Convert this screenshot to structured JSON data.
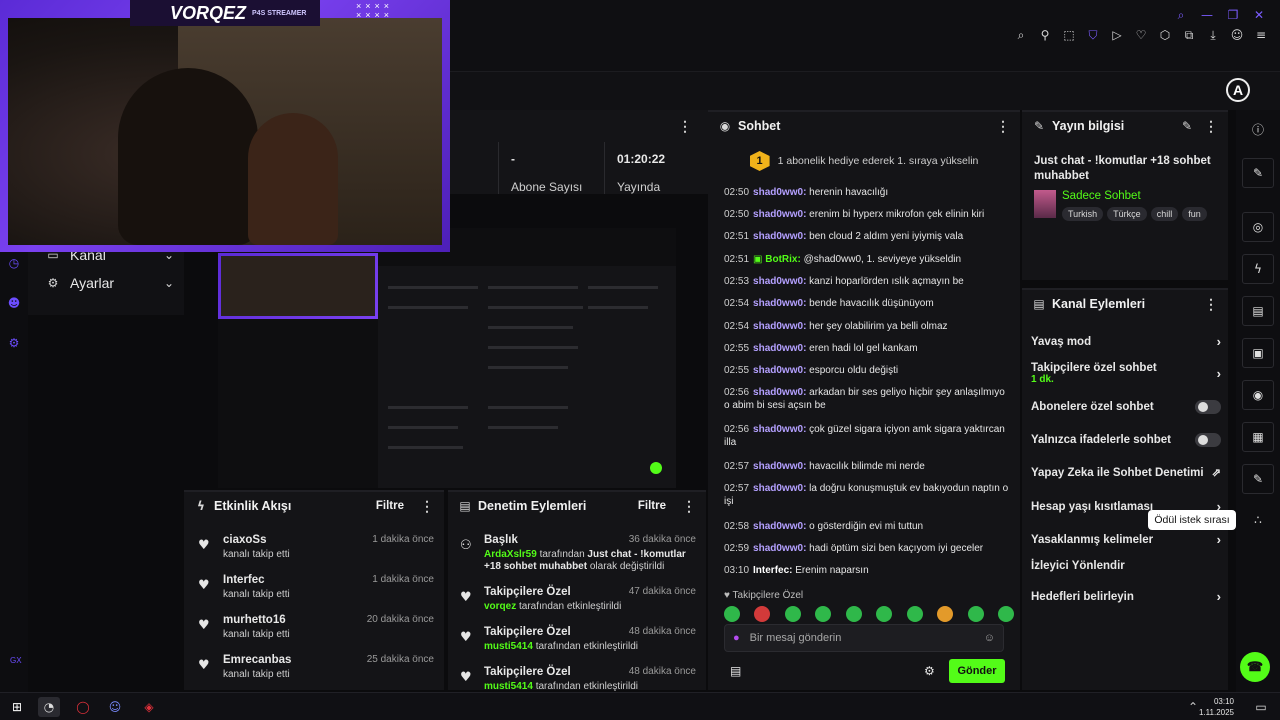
{
  "webcam": {
    "brand": "VORQEZ",
    "tagline": "P4S STREAMER"
  },
  "sidebar": {
    "items": [
      {
        "label": "Kanal"
      },
      {
        "label": "Ayarlar"
      }
    ],
    "gx": "GX"
  },
  "stats": {
    "subs_value": "-",
    "subs_label": "Abone Sayısı",
    "uptime_value": "01:20:22",
    "uptime_label": "Yayında"
  },
  "chat": {
    "title": "Sohbet",
    "banner": "1 abonelik hediye ederek 1. sıraya yükselin",
    "banner_rank": "1",
    "messages": [
      {
        "time": "02:50",
        "user": "shad0ww0",
        "text": "herenin havacılığı"
      },
      {
        "time": "02:50",
        "user": "shad0ww0",
        "text": "erenim bi hyperx mikrofon çek elinin kiri"
      },
      {
        "time": "02:51",
        "user": "shad0ww0",
        "text": "ben cloud 2 aldım yeni iyiymiş vala"
      },
      {
        "time": "02:51",
        "user": "BotRix",
        "text": "@shad0ww0, 1. seviyeye yükseldin",
        "bot": true
      },
      {
        "time": "02:53",
        "user": "shad0ww0",
        "text": "kanzi hoparlörden ıslık açmayın be"
      },
      {
        "time": "02:54",
        "user": "shad0ww0",
        "text": "bende havacılık düşünüyom"
      },
      {
        "time": "02:54",
        "user": "shad0ww0",
        "text": "her şey olabilirim ya belli olmaz"
      },
      {
        "time": "02:55",
        "user": "shad0ww0",
        "text": "eren hadi lol gel kankam"
      },
      {
        "time": "02:55",
        "user": "shad0ww0",
        "text": "esporcu oldu değişti"
      },
      {
        "time": "02:56",
        "user": "shad0ww0",
        "text": "arkadan bir ses geliyo hiçbir şey anlaşılmıyo o abim bi sesi açsın be"
      },
      {
        "time": "02:56",
        "user": "shad0ww0",
        "text": "çok güzel sigara içiyon amk sigara yaktırcan illa"
      },
      {
        "time": "02:57",
        "user": "shad0ww0",
        "text": "havacılık bilimde mi nerde"
      },
      {
        "time": "02:57",
        "user": "shad0ww0",
        "text": "la doğru konuşmuştuk ev bakıyodun naptın o işi"
      },
      {
        "time": "02:58",
        "user": "shad0ww0",
        "text": "o gösterdiğin evi mi tuttun"
      },
      {
        "time": "02:59",
        "user": "shad0ww0",
        "text": "hadi öptüm sizi ben kaçıyom iyi geceler"
      },
      {
        "time": "03:10",
        "user": "Interfec",
        "text": "Erenim naparsın",
        "white": true
      }
    ],
    "followers_only": "Takipçilere Özel",
    "input_placeholder": "Bir mesaj gönderin",
    "send_label": "Gönder"
  },
  "stream_info": {
    "title": "Yayın bilgisi",
    "stream_title": "Just chat - !komutlar +18 sohbet muhabbet",
    "category": "Sadece Sohbet",
    "tags": [
      "Turkish",
      "Türkçe",
      "chill",
      "fun"
    ]
  },
  "channel_actions": {
    "title": "Kanal Eylemleri",
    "items": [
      {
        "label": "Yavaş mod",
        "control": "chevron"
      },
      {
        "label": "Takipçilere özel sohbet",
        "sub": "1 dk.",
        "control": "chevron"
      },
      {
        "label": "Abonelere özel sohbet",
        "control": "toggle"
      },
      {
        "label": "Yalnızca ifadelerle sohbet",
        "control": "toggle"
      },
      {
        "label": "Yapay Zeka ile Sohbet Denetimi",
        "control": "external"
      },
      {
        "label": "Hesap yaşı kısıtlaması",
        "control": "chevron"
      },
      {
        "label": "Yasaklanmış kelimeler",
        "control": "chevron"
      },
      {
        "label": "İzleyici Yönlendir",
        "control": "none"
      },
      {
        "label": "Hedefleri belirleyin",
        "control": "chevron"
      }
    ],
    "tooltip": "Ödül istek sırası"
  },
  "activity": {
    "title": "Etkinlik Akışı",
    "filter": "Filtre",
    "items": [
      {
        "name": "ciaxoSs",
        "desc": "kanalı takip etti",
        "ago": "1 dakika önce"
      },
      {
        "name": "Interfec",
        "desc": "kanalı takip etti",
        "ago": "1 dakika önce"
      },
      {
        "name": "murhetto16",
        "desc": "kanalı takip etti",
        "ago": "20 dakika önce"
      },
      {
        "name": "Emrecanbas",
        "desc": "kanalı takip etti",
        "ago": "25 dakika önce"
      }
    ]
  },
  "moderation": {
    "title": "Denetim Eylemleri",
    "filter": "Filtre",
    "items": [
      {
        "name": "Başlık",
        "by": "ArdaXslr59",
        "mid": "tarafından",
        "strong": "Just chat - !komutlar +18 sohbet muhabbet",
        "end": "olarak değiştirildi",
        "ago": "36 dakika önce",
        "icon": "user"
      },
      {
        "name": "Takipçilere Özel",
        "by": "vorqez",
        "mid": "tarafından etkinleştirildi",
        "strong": "",
        "end": "",
        "ago": "47 dakika önce",
        "icon": "heart"
      },
      {
        "name": "Takipçilere Özel",
        "by": "musti5414",
        "mid": "tarafından etkinleştirildi",
        "strong": "",
        "end": "",
        "ago": "48 dakika önce",
        "icon": "heart"
      },
      {
        "name": "Takipçilere Özel",
        "by": "musti5414",
        "mid": "tarafından etkinleştirildi",
        "strong": "",
        "end": "",
        "ago": "48 dakika önce",
        "icon": "heart"
      }
    ]
  },
  "taskbar": {
    "time": "03:10",
    "date": "1.11.2025"
  },
  "colors": {
    "accent": "#53fc18",
    "purple": "#7b5cff",
    "username": "#b4a0ff"
  }
}
